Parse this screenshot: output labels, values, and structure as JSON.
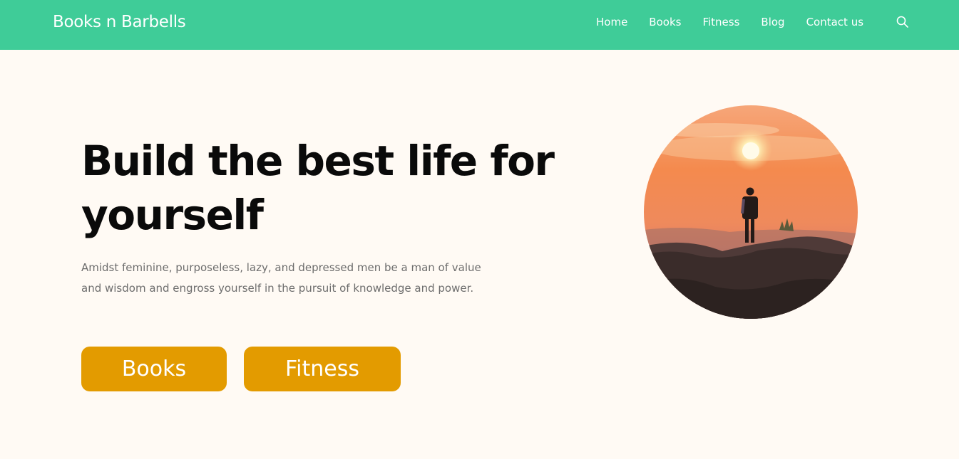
{
  "header": {
    "brand": "Books n Barbells",
    "nav": [
      "Home",
      "Books",
      "Fitness",
      "Blog",
      "Contact us"
    ],
    "search_icon": "search-icon",
    "background": "#3fcc98"
  },
  "hero": {
    "title": "Build the best life for yourself",
    "description": "Amidst feminine, purposeless, lazy, and depressed men be a man of value and wisdom and engross yourself in the pursuit of knowledge and power.",
    "buttons": [
      "Books",
      "Fitness"
    ],
    "button_color": "#e39b00",
    "image": "man-on-mountain-at-sunset"
  }
}
